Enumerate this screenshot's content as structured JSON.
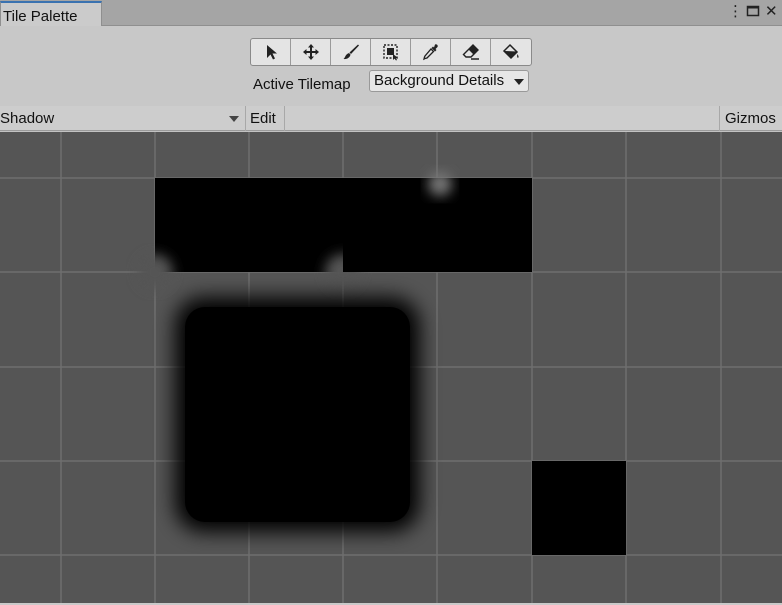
{
  "window": {
    "tab_title": "Tile Palette",
    "menu_icon": "kebab-menu-icon",
    "maximize_icon": "maximize-icon",
    "close_icon": "close-icon"
  },
  "toolbar": {
    "tools": [
      {
        "name": "select-tool",
        "icon": "cursor-arrow-icon"
      },
      {
        "name": "move-tool",
        "icon": "move-arrows-icon"
      },
      {
        "name": "paint-tool",
        "icon": "brush-icon"
      },
      {
        "name": "box-fill-tool",
        "icon": "box-select-icon"
      },
      {
        "name": "pick-tool",
        "icon": "eyedropper-icon"
      },
      {
        "name": "erase-tool",
        "icon": "eraser-icon"
      },
      {
        "name": "fill-tool",
        "icon": "paint-bucket-icon"
      }
    ],
    "active_tilemap_label": "Active Tilemap",
    "active_tilemap_value": "Background Details"
  },
  "palette_bar": {
    "palette_name": "Shadow",
    "edit_label": "Edit",
    "gizmos_label": "Gizmos"
  },
  "colors": {
    "grid_background": "#555555",
    "grid_line": "#6e6e6e",
    "tile": "#000000",
    "tab_accent": "#3a72b0"
  }
}
